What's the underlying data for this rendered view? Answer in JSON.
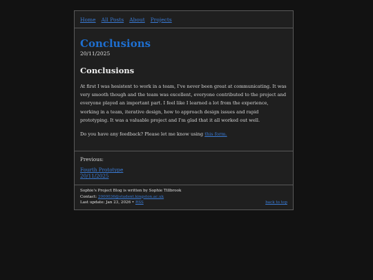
{
  "nav": {
    "items": [
      "Home",
      "All Posts",
      "About",
      "Projects"
    ]
  },
  "post": {
    "title": "Conclusions",
    "date": "20/11/2025",
    "heading": "Conclusions",
    "paragraph1": "At first I was hesistent to work in a team, I've never been great at communicating. It was very smooth though and the team was excellent, everyone contributed to the project and everyone played an important part. I feel like I learned a lot from the experience, working in a team, iterative design, how to approach design issues and rapid prototyping. It was a valuable project and I'm glad that it all worked out well.",
    "feedback_text": "Do you have any feedback? Please let me know using ",
    "feedback_link": "this form."
  },
  "previous": {
    "label": "Previous:",
    "post_title": "Fourth Prototype",
    "post_date": "20/11/2025"
  },
  "footer": {
    "byline": "Sophie's Project Blog is written by Sophie Tillbrook",
    "contact_label": "Contact: ",
    "contact_email": "2000036@student.kingston.ac.uk",
    "update_text": "Last update: Jan 23, 2026 • ",
    "rss_label": "RSS",
    "back_to_top": "back to top"
  },
  "colors": {
    "background": "#121212",
    "panel": "#1f1f1f",
    "link": "#3a7bd5",
    "title": "#1e6fd0"
  }
}
